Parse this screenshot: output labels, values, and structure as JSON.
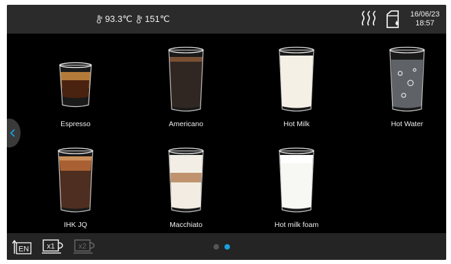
{
  "status": {
    "boiler1_temp": "93.3℃",
    "boiler2_temp": "151℃",
    "date": "16/06/23",
    "time": "18:57"
  },
  "drinks": [
    {
      "name": "Espresso",
      "type": "espresso"
    },
    {
      "name": "Americano",
      "type": "americano"
    },
    {
      "name": "Hot Milk",
      "type": "milk"
    },
    {
      "name": "Hot Water",
      "type": "water"
    },
    {
      "name": "IHK JQ",
      "type": "ihk"
    },
    {
      "name": "Macchiato",
      "type": "macchiato"
    },
    {
      "name": "Hot milk foam",
      "type": "foam"
    }
  ],
  "bottom": {
    "language": "EN",
    "single_cup": "x1",
    "double_cup": "x2"
  },
  "pagination": {
    "pages": 2,
    "current": 2
  },
  "colors": {
    "accent": "#1a9fe0",
    "background": "#000000",
    "bar": "#2b2b2b"
  },
  "icons": [
    "thermometer-icon",
    "steam-icon",
    "water-tank-icon",
    "chevron-left-icon",
    "language-icon",
    "single-cup-icon",
    "double-cup-icon"
  ]
}
